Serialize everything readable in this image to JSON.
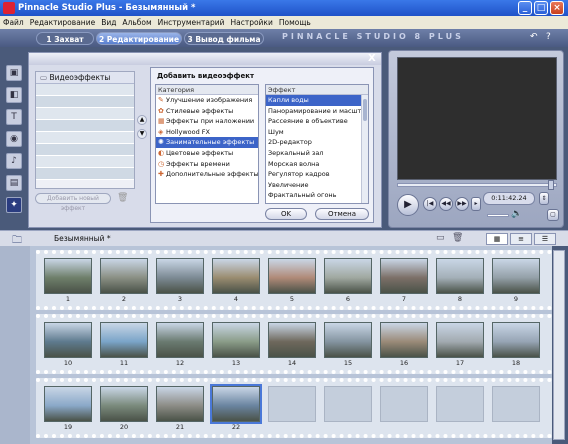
{
  "window": {
    "title": "Pinnacle Studio Plus - Безымянный *",
    "colors": {
      "titlebar": "#1f52c8",
      "accent": "#3c64c8",
      "background": "#4a5a7a"
    }
  },
  "menu": [
    "Файл",
    "Редактирование",
    "Вид",
    "Альбом",
    "Инструментарий",
    "Настройки",
    "Помощь"
  ],
  "tabs": [
    {
      "label": "1 Захват",
      "active": false
    },
    {
      "label": "2 Редактирование",
      "active": true
    },
    {
      "label": "3 Вывод фильма",
      "active": false
    }
  ],
  "brand": "PINNACLE STUDIO 8 PLUS",
  "tools": [
    {
      "icon": "clapper-icon"
    },
    {
      "icon": "transition-icon"
    },
    {
      "icon": "title-icon"
    },
    {
      "icon": "camera-icon"
    },
    {
      "icon": "audio-icon"
    },
    {
      "icon": "menu-icon"
    },
    {
      "icon": "effects-icon",
      "selected": true
    }
  ],
  "effects_panel": {
    "header": "Видеоэффекты",
    "add_button": "Добавить новый эффект"
  },
  "dialog": {
    "title": "Добавить видеоэффект",
    "close_glyph": "X",
    "categories_header": "Категория",
    "effects_header": "Эффект",
    "categories": [
      "Улучшение изображения",
      "Стилевые эффекты",
      "Эффекты при наложении",
      "Hollywood FX",
      "Занимательные эффекты",
      "Цветовые эффекты",
      "Эффекты времени",
      "Дополнительные эффекты"
    ],
    "categories_selected_index": 4,
    "effects": [
      "Капли воды",
      "Панорамирование и масштаб",
      "Рассеяние в объективе",
      "Шум",
      "2D-редактор",
      "Зеркальный зал",
      "Морская волна",
      "Регулятор кадров",
      "Увеличение",
      "Фрактальный огонь"
    ],
    "effects_selected_index": 0,
    "ok_label": "OK",
    "cancel_label": "Отмена"
  },
  "player": {
    "timecode": "0:11:42.24",
    "scrub_position": 0.95
  },
  "album": {
    "name": "Безымянный *"
  },
  "storyboard": {
    "rows": [
      {
        "cells": [
          {
            "num": "1",
            "color": "#6e7f6a"
          },
          {
            "num": "2",
            "color": "#8a8f84"
          },
          {
            "num": "3",
            "color": "#7c8a94"
          },
          {
            "num": "4",
            "color": "#9a8c70"
          },
          {
            "num": "5",
            "color": "#b08a78"
          },
          {
            "num": "6",
            "color": "#a0a8a0"
          },
          {
            "num": "7",
            "color": "#7c7068"
          },
          {
            "num": "8",
            "color": "#a4b0b8"
          },
          {
            "num": "9",
            "color": "#94a0a8"
          }
        ]
      },
      {
        "cells": [
          {
            "num": "10",
            "color": "#5e7a8e"
          },
          {
            "num": "11",
            "color": "#7aa4c8"
          },
          {
            "num": "12",
            "color": "#6a7a70"
          },
          {
            "num": "13",
            "color": "#8a9c88"
          },
          {
            "num": "14",
            "color": "#6e685c"
          },
          {
            "num": "15",
            "color": "#8494a0"
          },
          {
            "num": "16",
            "color": "#9a8a78"
          },
          {
            "num": "17",
            "color": "#a2aab0"
          },
          {
            "num": "18",
            "color": "#96a4b4"
          }
        ]
      },
      {
        "cells": [
          {
            "num": "19",
            "color": "#8aa8c8"
          },
          {
            "num": "20",
            "color": "#7a8a7c"
          },
          {
            "num": "21",
            "color": "#8c8c86"
          },
          {
            "num": "22",
            "color": "#6a84a0",
            "selected": true
          },
          {
            "num": "",
            "empty": true
          },
          {
            "num": "",
            "empty": true
          },
          {
            "num": "",
            "empty": true
          },
          {
            "num": "",
            "empty": true
          },
          {
            "num": "",
            "empty": true
          }
        ]
      }
    ]
  }
}
